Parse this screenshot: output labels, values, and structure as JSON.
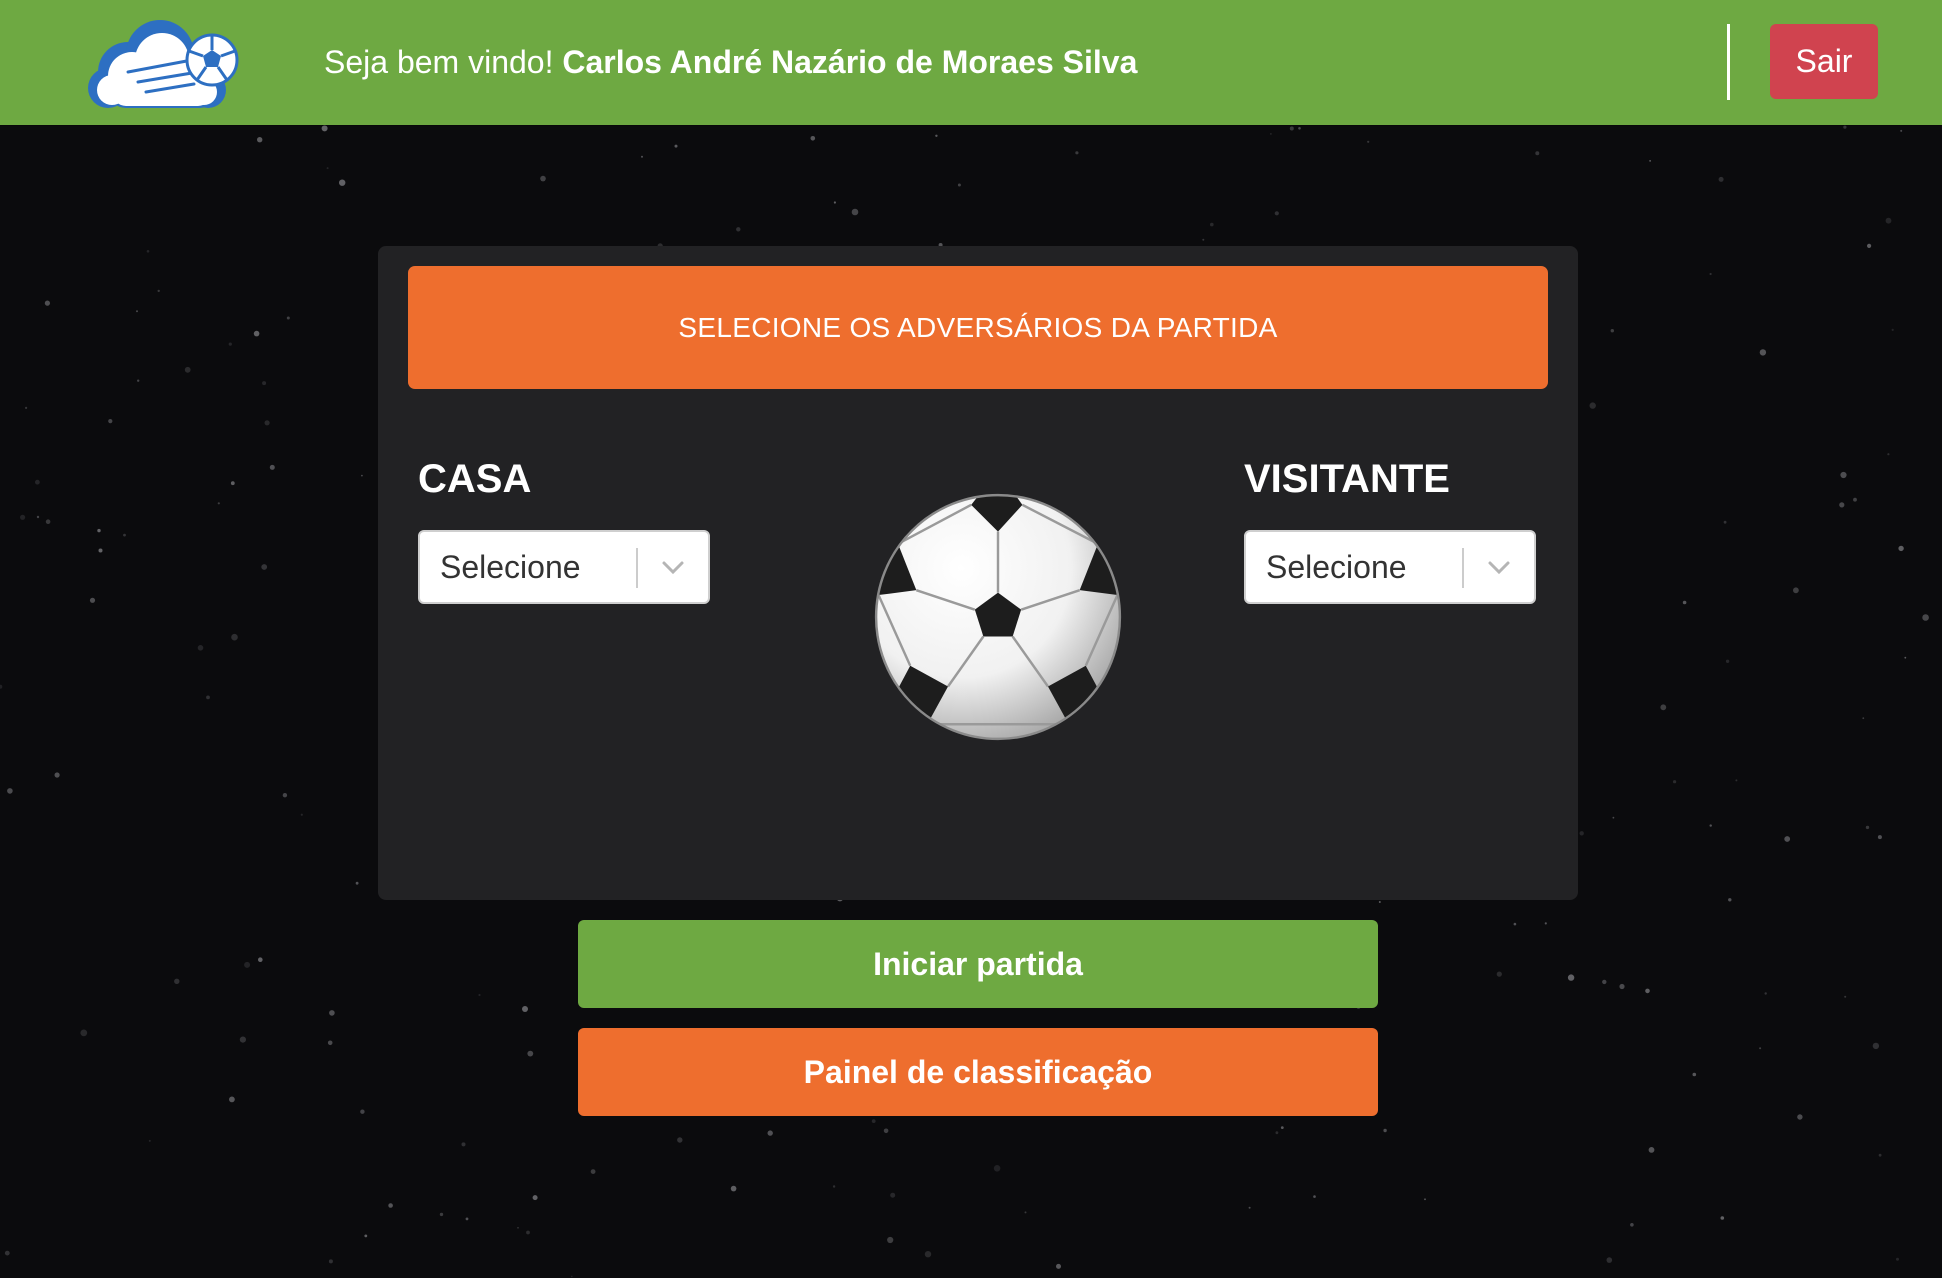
{
  "colors": {
    "header_green": "#6ea942",
    "accent_orange": "#ee6e2e",
    "danger_red": "#d0434f",
    "panel_bg": "#222224",
    "page_bg": "#0b0b0d"
  },
  "header": {
    "logo_icon": "cloud-soccer-ball-logo",
    "welcome_text": "Seja bem vindo!",
    "user_name": "Carlos André Nazário de Moraes Silva",
    "logout_label": "Sair"
  },
  "panel": {
    "title": "SELECIONE OS ADVERSÁRIOS DA PARTIDA",
    "home": {
      "label": "CASA",
      "select_value": "Selecione"
    },
    "away": {
      "label": "VISITANTE",
      "select_value": "Selecione"
    },
    "center_icon": "soccer-ball"
  },
  "actions": {
    "start_label": "Iniciar partida",
    "ranking_label": "Painel de classificação"
  }
}
